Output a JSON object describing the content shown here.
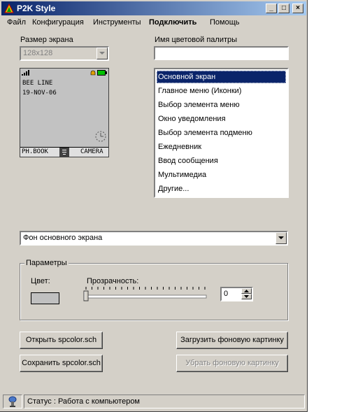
{
  "window": {
    "title": "P2K Style",
    "controls": {
      "minimize": "_",
      "maximize": "□",
      "close": "×"
    }
  },
  "menu": [
    "Файл",
    "Конфигурация",
    "Инструменты",
    "Подключить",
    "Помощь"
  ],
  "screen_size": {
    "label": "Размер экрана",
    "value": "128x128"
  },
  "palette_name": {
    "label": "Имя цветовой палитры",
    "value": ""
  },
  "phone_preview": {
    "operator": "BEE LINE",
    "date": "19-NOV-06",
    "left_soft": "PH.BOOK",
    "right_soft": "CAMERA"
  },
  "palette_list": {
    "items": [
      "Основной экран",
      "Главное меню (Иконки)",
      "Выбор элемента меню",
      "Окно уведомления",
      "Выбор элемента подменю",
      "Ежедневник",
      "Ввод сообщения",
      "Мультимедиа",
      "Другие..."
    ],
    "selected_index": 0
  },
  "element_select": {
    "value": "Фон основного экрана"
  },
  "params": {
    "legend": "Параметры",
    "color_label": "Цвет:",
    "color_value": "#c0c0c0",
    "transparency_label": "Прозрачность:",
    "transparency_value": "0",
    "slider_fraction": 0
  },
  "buttons": {
    "open": "Открыть spcolor.sch",
    "save": "Сохранить spcolor.sch",
    "load_bg": "Загрузить фоновую картинку",
    "remove_bg": "Убрать фоновую картинку"
  },
  "status": {
    "text": "Статус : Работа с компьютером"
  },
  "colors": {
    "titlebar_start": "#0a246a",
    "titlebar_end": "#a6caf0",
    "face": "#d4d0c8",
    "selection": "#0a246a"
  }
}
